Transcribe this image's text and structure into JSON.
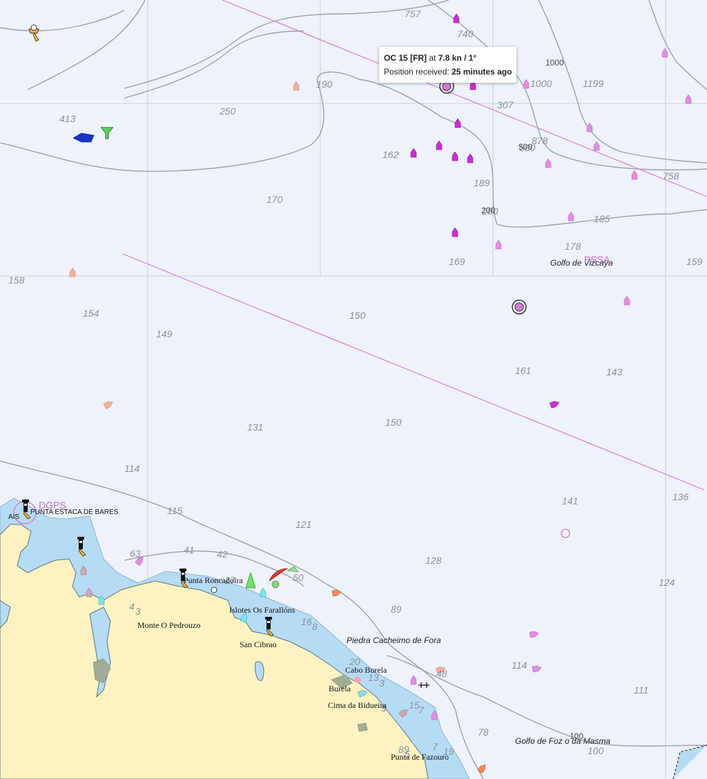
{
  "tooltip": {
    "vessel_name": "OC 15 [FR]",
    "at_text": "at",
    "speed_course": "7.8 kn / 1°",
    "position_label": "Position received:",
    "position_age": "25 minutes ago"
  },
  "depths": [
    "757",
    "740",
    "1000",
    "1199",
    "190",
    "307",
    "878",
    "500",
    "250",
    "413",
    "162",
    "189",
    "758",
    "200",
    "185",
    "170",
    "178",
    "169",
    "159",
    "158",
    "154",
    "150",
    "149",
    "161",
    "143",
    "131",
    "150",
    "114",
    "141",
    "136",
    "115",
    "121",
    "63",
    "41",
    "42",
    "128",
    "124",
    "17",
    "50",
    "89",
    "4",
    "3",
    "16",
    "8",
    "20",
    "114",
    "13",
    "3",
    "48",
    "111",
    "15",
    "7",
    "9",
    "78",
    "100",
    "89",
    "5",
    "7",
    "19",
    "1"
  ],
  "contour_labels": {
    "c1000": "1000",
    "c500": "500",
    "c200": "200",
    "c100": "100"
  },
  "sea_names": {
    "golfo_vizcaya": "Golfo de Vizcaya",
    "piedra": "Piedra Cacheimo de Fora",
    "golfo_foz": "Golfo de Foz o da Masma"
  },
  "special_labels": {
    "pssa": "PSSA",
    "dgps": "DGPS",
    "ais": "AIS",
    "estaca": "PUNTA ESTACA DE BARES"
  },
  "places": {
    "roncadoira": "Punta Roncadoira",
    "farallons": "Islotes Os Farallóns",
    "pedrouzo": "Monte O Pedrouzo",
    "cibrao": "San Cibrao",
    "burela_cabo": "Cabo Burela",
    "burela": "Burela",
    "bidueira": "Cima da Bidueira",
    "fazouro": "Punta de Fazouro"
  },
  "colors": {
    "sea": "#eef2fb",
    "shallow": "#b6dbf4",
    "land": "#fdf3c2",
    "contour": "#9aa0a8",
    "grid": "#c9cfdc",
    "traffic_lane": "#d37ed3",
    "fishing_vessel": "#cc2ed1",
    "selected_ring": "#333333"
  },
  "icons": [
    "lighthouse-icon",
    "fishing-vessel-icon",
    "cargo-vessel-icon",
    "sailing-vessel-icon",
    "buoy-icon",
    "target-ring-icon"
  ]
}
